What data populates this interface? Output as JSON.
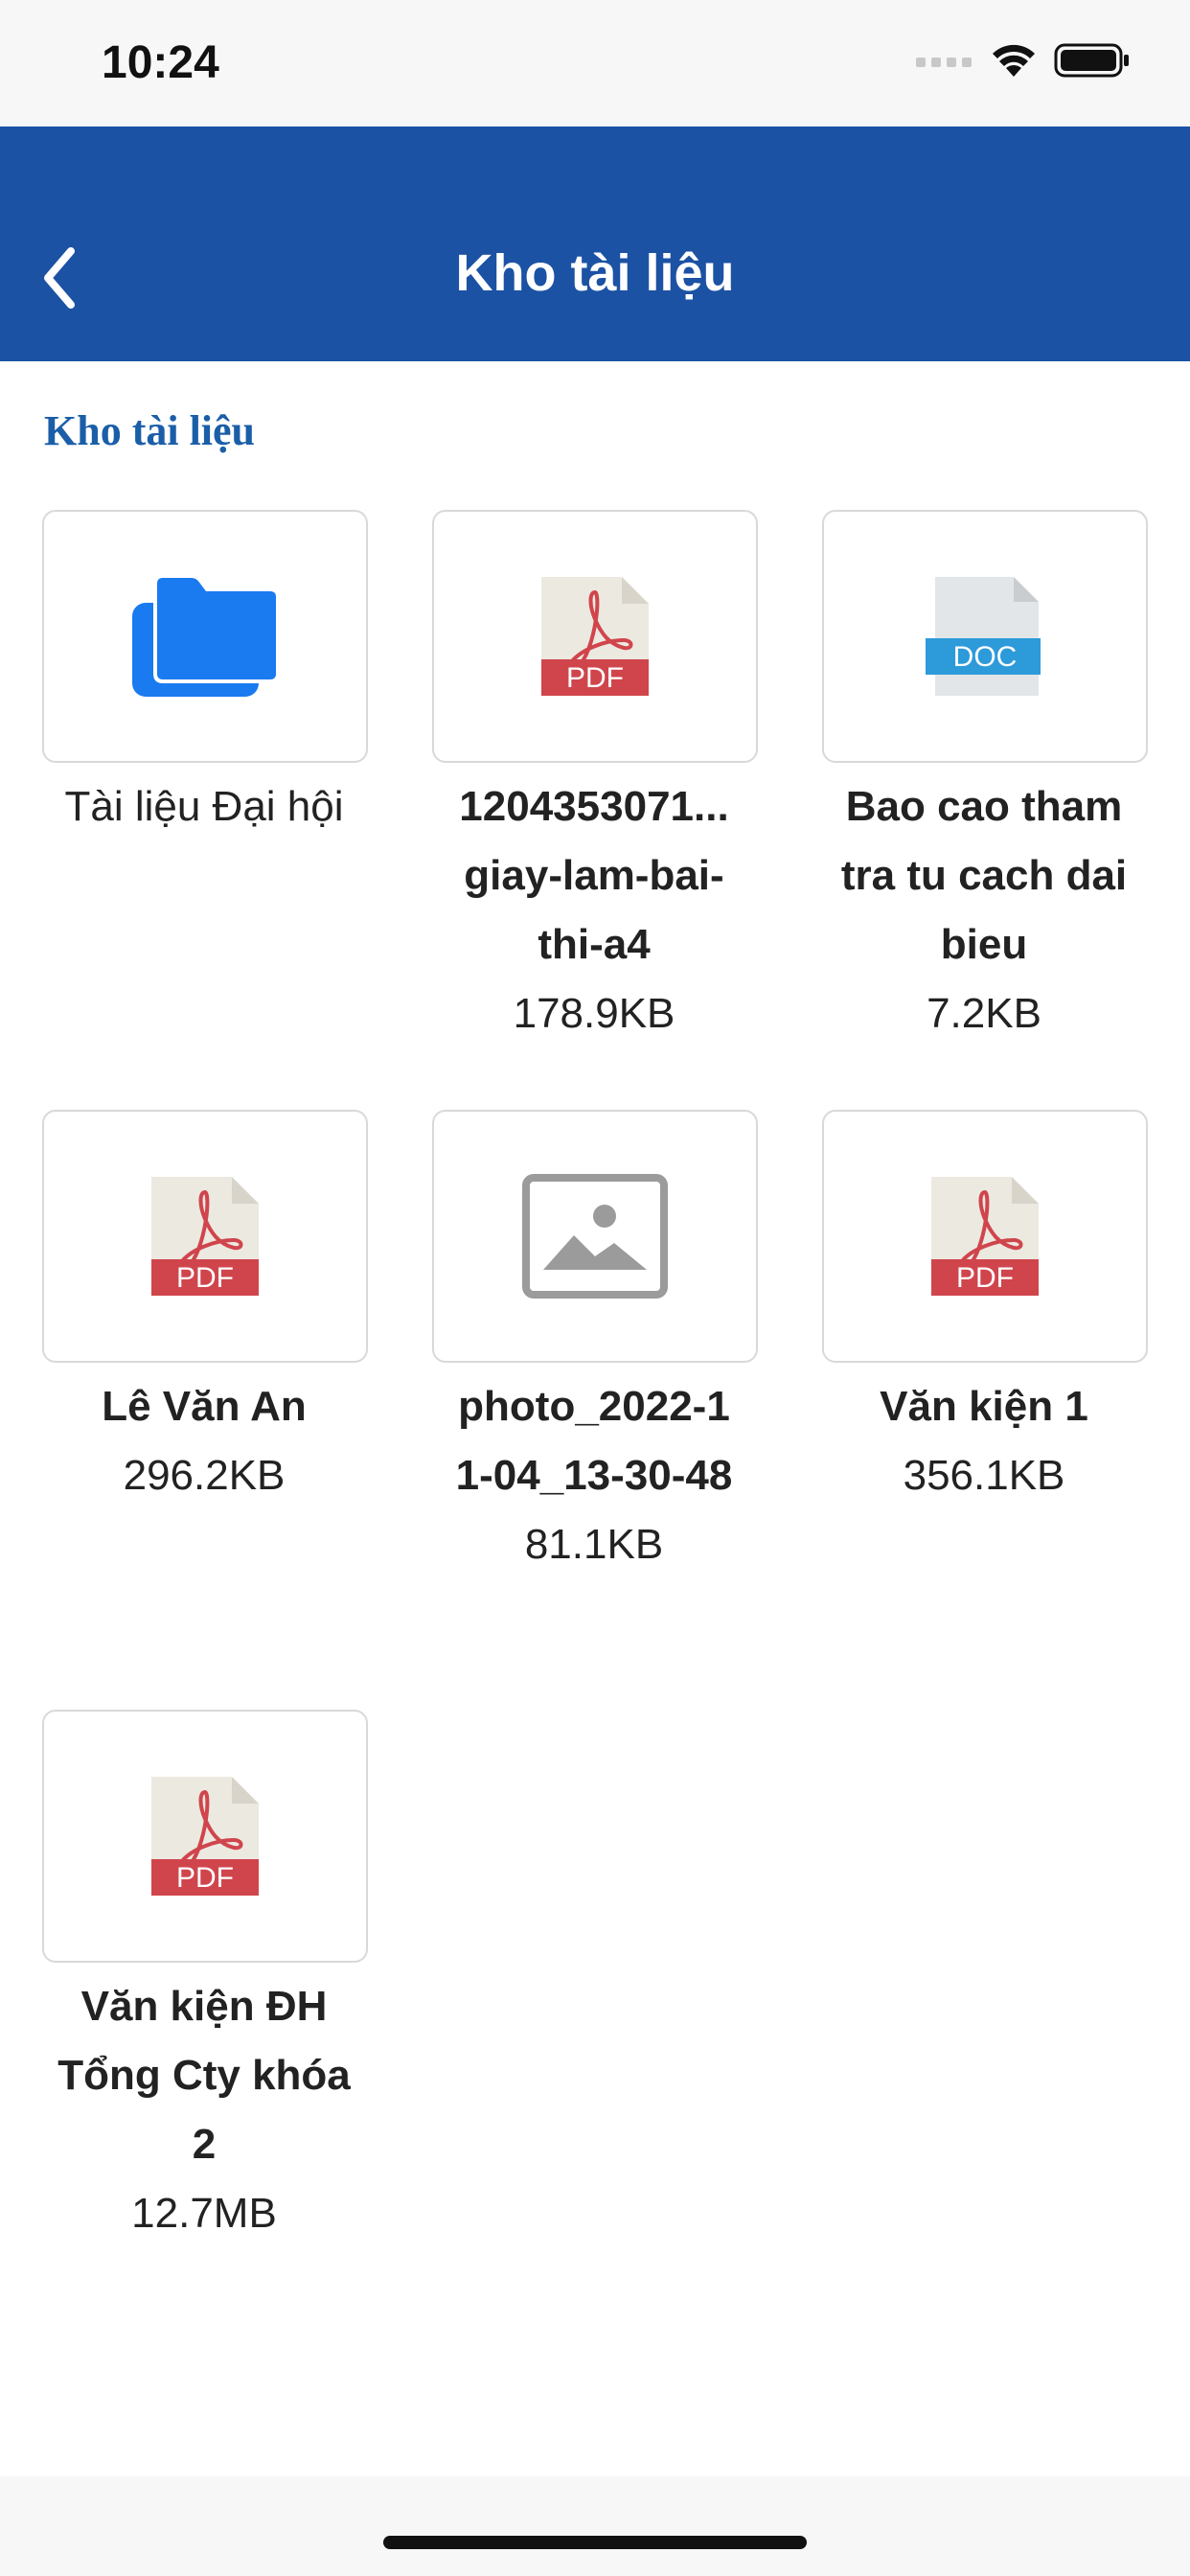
{
  "status_bar": {
    "time": "10:24"
  },
  "nav": {
    "title": "Kho tài liệu",
    "back_icon": "chevron-left-icon"
  },
  "section": {
    "title": "Kho tài liệu"
  },
  "items": [
    {
      "type": "folder",
      "icon": "folder-icon",
      "name": "Tài liệu Đại hội",
      "size": ""
    },
    {
      "type": "pdf",
      "icon": "pdf-file-icon",
      "icon_label": "PDF",
      "name_line1": "1204353071...",
      "name_rest": "giay-lam-bai-thi-a4",
      "size": "178.9KB"
    },
    {
      "type": "doc",
      "icon": "doc-file-icon",
      "icon_label": "DOC",
      "name": "Bao cao tham tra tu cach dai bieu",
      "size": "7.2KB"
    },
    {
      "type": "pdf",
      "icon": "pdf-file-icon",
      "icon_label": "PDF",
      "name": "Lê Văn An",
      "size": "296.2KB"
    },
    {
      "type": "image",
      "icon": "image-icon",
      "name": "photo_2022-11-04_13-30-48",
      "size": "81.1KB"
    },
    {
      "type": "pdf",
      "icon": "pdf-file-icon",
      "icon_label": "PDF",
      "name": "Văn kiện 1",
      "size": "356.1KB"
    },
    {
      "type": "pdf",
      "icon": "pdf-file-icon",
      "icon_label": "PDF",
      "name": "Văn kiện ĐH Tổng Cty khóa 2",
      "size": "12.7MB"
    }
  ],
  "colors": {
    "nav_bg": "#1b52a4",
    "section_title": "#1b5ea8",
    "folder": "#1a7af0",
    "pdf_red": "#d0454c",
    "doc_blue": "#2d9ad9"
  }
}
